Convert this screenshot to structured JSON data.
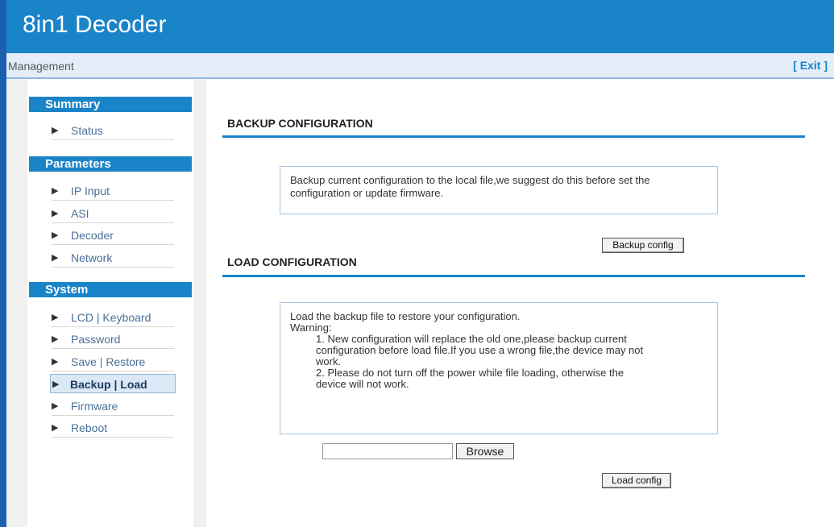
{
  "app": {
    "title": "8in1 Decoder",
    "management_label": "Management",
    "exit_label": "[ Exit ]"
  },
  "sidebar": {
    "sections": [
      {
        "label": "Summary"
      },
      {
        "label": "Parameters"
      },
      {
        "label": "System"
      }
    ],
    "items": [
      {
        "label": "Status"
      },
      {
        "label": "IP Input"
      },
      {
        "label": "ASI"
      },
      {
        "label": "Decoder"
      },
      {
        "label": "Network"
      },
      {
        "label": "LCD | Keyboard"
      },
      {
        "label": "Password"
      },
      {
        "label": "Save | Restore"
      },
      {
        "label": "Backup | Load"
      },
      {
        "label": "Firmware"
      },
      {
        "label": "Reboot"
      }
    ],
    "active_item": "Backup | Load"
  },
  "backup": {
    "title": "BACKUP CONFIGURATION",
    "description_line1": "Backup current configuration to the local file,we suggest do this before set the",
    "description_line2": "configuration or update firmware.",
    "button_label": "Backup config"
  },
  "load": {
    "title": "LOAD CONFIGURATION",
    "line1": "Load the backup file to restore your configuration.",
    "line2": "Warning:",
    "line3": "1. New configuration will replace the old one,please backup current",
    "line4": "configuration before load file.If you use a wrong file,the device may not",
    "line5": "work.",
    "line6": "2. Please do not turn off the power while file loading, otherwise the",
    "line7": "device will not work.",
    "file_value": "",
    "browse_label": "Browse",
    "button_label": "Load config"
  },
  "colors": {
    "header": "#1a84c8",
    "left_edge": "#1b5fb0",
    "mgmt_bar": "#e3eef8"
  }
}
